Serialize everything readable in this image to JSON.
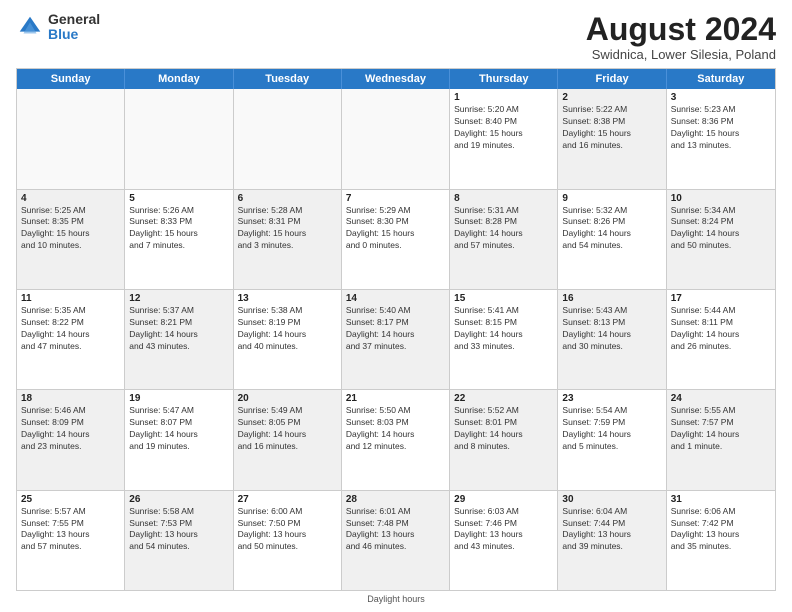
{
  "logo": {
    "general": "General",
    "blue": "Blue"
  },
  "title": "August 2024",
  "subtitle": "Swidnica, Lower Silesia, Poland",
  "days": [
    "Sunday",
    "Monday",
    "Tuesday",
    "Wednesday",
    "Thursday",
    "Friday",
    "Saturday"
  ],
  "footer": "Daylight hours",
  "rows": [
    [
      {
        "day": "",
        "content": "",
        "shaded": false,
        "empty": true
      },
      {
        "day": "",
        "content": "",
        "shaded": false,
        "empty": true
      },
      {
        "day": "",
        "content": "",
        "shaded": false,
        "empty": true
      },
      {
        "day": "",
        "content": "",
        "shaded": false,
        "empty": true
      },
      {
        "day": "1",
        "content": "Sunrise: 5:20 AM\nSunset: 8:40 PM\nDaylight: 15 hours\nand 19 minutes.",
        "shaded": false,
        "empty": false
      },
      {
        "day": "2",
        "content": "Sunrise: 5:22 AM\nSunset: 8:38 PM\nDaylight: 15 hours\nand 16 minutes.",
        "shaded": true,
        "empty": false
      },
      {
        "day": "3",
        "content": "Sunrise: 5:23 AM\nSunset: 8:36 PM\nDaylight: 15 hours\nand 13 minutes.",
        "shaded": false,
        "empty": false
      }
    ],
    [
      {
        "day": "4",
        "content": "Sunrise: 5:25 AM\nSunset: 8:35 PM\nDaylight: 15 hours\nand 10 minutes.",
        "shaded": true,
        "empty": false
      },
      {
        "day": "5",
        "content": "Sunrise: 5:26 AM\nSunset: 8:33 PM\nDaylight: 15 hours\nand 7 minutes.",
        "shaded": false,
        "empty": false
      },
      {
        "day": "6",
        "content": "Sunrise: 5:28 AM\nSunset: 8:31 PM\nDaylight: 15 hours\nand 3 minutes.",
        "shaded": true,
        "empty": false
      },
      {
        "day": "7",
        "content": "Sunrise: 5:29 AM\nSunset: 8:30 PM\nDaylight: 15 hours\nand 0 minutes.",
        "shaded": false,
        "empty": false
      },
      {
        "day": "8",
        "content": "Sunrise: 5:31 AM\nSunset: 8:28 PM\nDaylight: 14 hours\nand 57 minutes.",
        "shaded": true,
        "empty": false
      },
      {
        "day": "9",
        "content": "Sunrise: 5:32 AM\nSunset: 8:26 PM\nDaylight: 14 hours\nand 54 minutes.",
        "shaded": false,
        "empty": false
      },
      {
        "day": "10",
        "content": "Sunrise: 5:34 AM\nSunset: 8:24 PM\nDaylight: 14 hours\nand 50 minutes.",
        "shaded": true,
        "empty": false
      }
    ],
    [
      {
        "day": "11",
        "content": "Sunrise: 5:35 AM\nSunset: 8:22 PM\nDaylight: 14 hours\nand 47 minutes.",
        "shaded": false,
        "empty": false
      },
      {
        "day": "12",
        "content": "Sunrise: 5:37 AM\nSunset: 8:21 PM\nDaylight: 14 hours\nand 43 minutes.",
        "shaded": true,
        "empty": false
      },
      {
        "day": "13",
        "content": "Sunrise: 5:38 AM\nSunset: 8:19 PM\nDaylight: 14 hours\nand 40 minutes.",
        "shaded": false,
        "empty": false
      },
      {
        "day": "14",
        "content": "Sunrise: 5:40 AM\nSunset: 8:17 PM\nDaylight: 14 hours\nand 37 minutes.",
        "shaded": true,
        "empty": false
      },
      {
        "day": "15",
        "content": "Sunrise: 5:41 AM\nSunset: 8:15 PM\nDaylight: 14 hours\nand 33 minutes.",
        "shaded": false,
        "empty": false
      },
      {
        "day": "16",
        "content": "Sunrise: 5:43 AM\nSunset: 8:13 PM\nDaylight: 14 hours\nand 30 minutes.",
        "shaded": true,
        "empty": false
      },
      {
        "day": "17",
        "content": "Sunrise: 5:44 AM\nSunset: 8:11 PM\nDaylight: 14 hours\nand 26 minutes.",
        "shaded": false,
        "empty": false
      }
    ],
    [
      {
        "day": "18",
        "content": "Sunrise: 5:46 AM\nSunset: 8:09 PM\nDaylight: 14 hours\nand 23 minutes.",
        "shaded": true,
        "empty": false
      },
      {
        "day": "19",
        "content": "Sunrise: 5:47 AM\nSunset: 8:07 PM\nDaylight: 14 hours\nand 19 minutes.",
        "shaded": false,
        "empty": false
      },
      {
        "day": "20",
        "content": "Sunrise: 5:49 AM\nSunset: 8:05 PM\nDaylight: 14 hours\nand 16 minutes.",
        "shaded": true,
        "empty": false
      },
      {
        "day": "21",
        "content": "Sunrise: 5:50 AM\nSunset: 8:03 PM\nDaylight: 14 hours\nand 12 minutes.",
        "shaded": false,
        "empty": false
      },
      {
        "day": "22",
        "content": "Sunrise: 5:52 AM\nSunset: 8:01 PM\nDaylight: 14 hours\nand 8 minutes.",
        "shaded": true,
        "empty": false
      },
      {
        "day": "23",
        "content": "Sunrise: 5:54 AM\nSunset: 7:59 PM\nDaylight: 14 hours\nand 5 minutes.",
        "shaded": false,
        "empty": false
      },
      {
        "day": "24",
        "content": "Sunrise: 5:55 AM\nSunset: 7:57 PM\nDaylight: 14 hours\nand 1 minute.",
        "shaded": true,
        "empty": false
      }
    ],
    [
      {
        "day": "25",
        "content": "Sunrise: 5:57 AM\nSunset: 7:55 PM\nDaylight: 13 hours\nand 57 minutes.",
        "shaded": false,
        "empty": false
      },
      {
        "day": "26",
        "content": "Sunrise: 5:58 AM\nSunset: 7:53 PM\nDaylight: 13 hours\nand 54 minutes.",
        "shaded": true,
        "empty": false
      },
      {
        "day": "27",
        "content": "Sunrise: 6:00 AM\nSunset: 7:50 PM\nDaylight: 13 hours\nand 50 minutes.",
        "shaded": false,
        "empty": false
      },
      {
        "day": "28",
        "content": "Sunrise: 6:01 AM\nSunset: 7:48 PM\nDaylight: 13 hours\nand 46 minutes.",
        "shaded": true,
        "empty": false
      },
      {
        "day": "29",
        "content": "Sunrise: 6:03 AM\nSunset: 7:46 PM\nDaylight: 13 hours\nand 43 minutes.",
        "shaded": false,
        "empty": false
      },
      {
        "day": "30",
        "content": "Sunrise: 6:04 AM\nSunset: 7:44 PM\nDaylight: 13 hours\nand 39 minutes.",
        "shaded": true,
        "empty": false
      },
      {
        "day": "31",
        "content": "Sunrise: 6:06 AM\nSunset: 7:42 PM\nDaylight: 13 hours\nand 35 minutes.",
        "shaded": false,
        "empty": false
      }
    ]
  ]
}
